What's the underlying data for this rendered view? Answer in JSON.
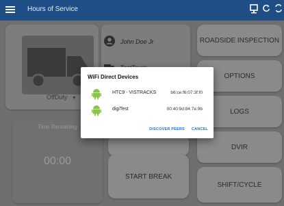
{
  "appbar": {
    "title": "Hours of Service",
    "icons": [
      "monitor-icon",
      "refresh-icon",
      "sync-icon"
    ]
  },
  "driver": {
    "name": "John Doe Jr",
    "co_driver": "TestTruck"
  },
  "status": {
    "current": "OffDuty"
  },
  "timer": {
    "label": "Time Remaining",
    "value": "00:00"
  },
  "buttons": {
    "roadside": "ROADSIDE INSPECTION",
    "options": "OPTIONS",
    "logs": "LOGS",
    "dvir": "DVIR",
    "shift_cycle": "SHIFT/CYCLE",
    "start_break": "START BREAK"
  },
  "dialog": {
    "title": "WiFi Direct Devices",
    "devices": [
      {
        "name": "HTC9 - VISTRACKS",
        "mac": "b6:ce:f6:07:3f:f0"
      },
      {
        "name": "digiTest",
        "mac": "00:40:9d:84:7e:9b"
      }
    ],
    "discover_label": "DISCOVER PEERS",
    "cancel_label": "CANCEL"
  },
  "colors": {
    "appbar": "#1f4e86",
    "accent": "#1a73c9",
    "android_green": "#8bc34a"
  }
}
